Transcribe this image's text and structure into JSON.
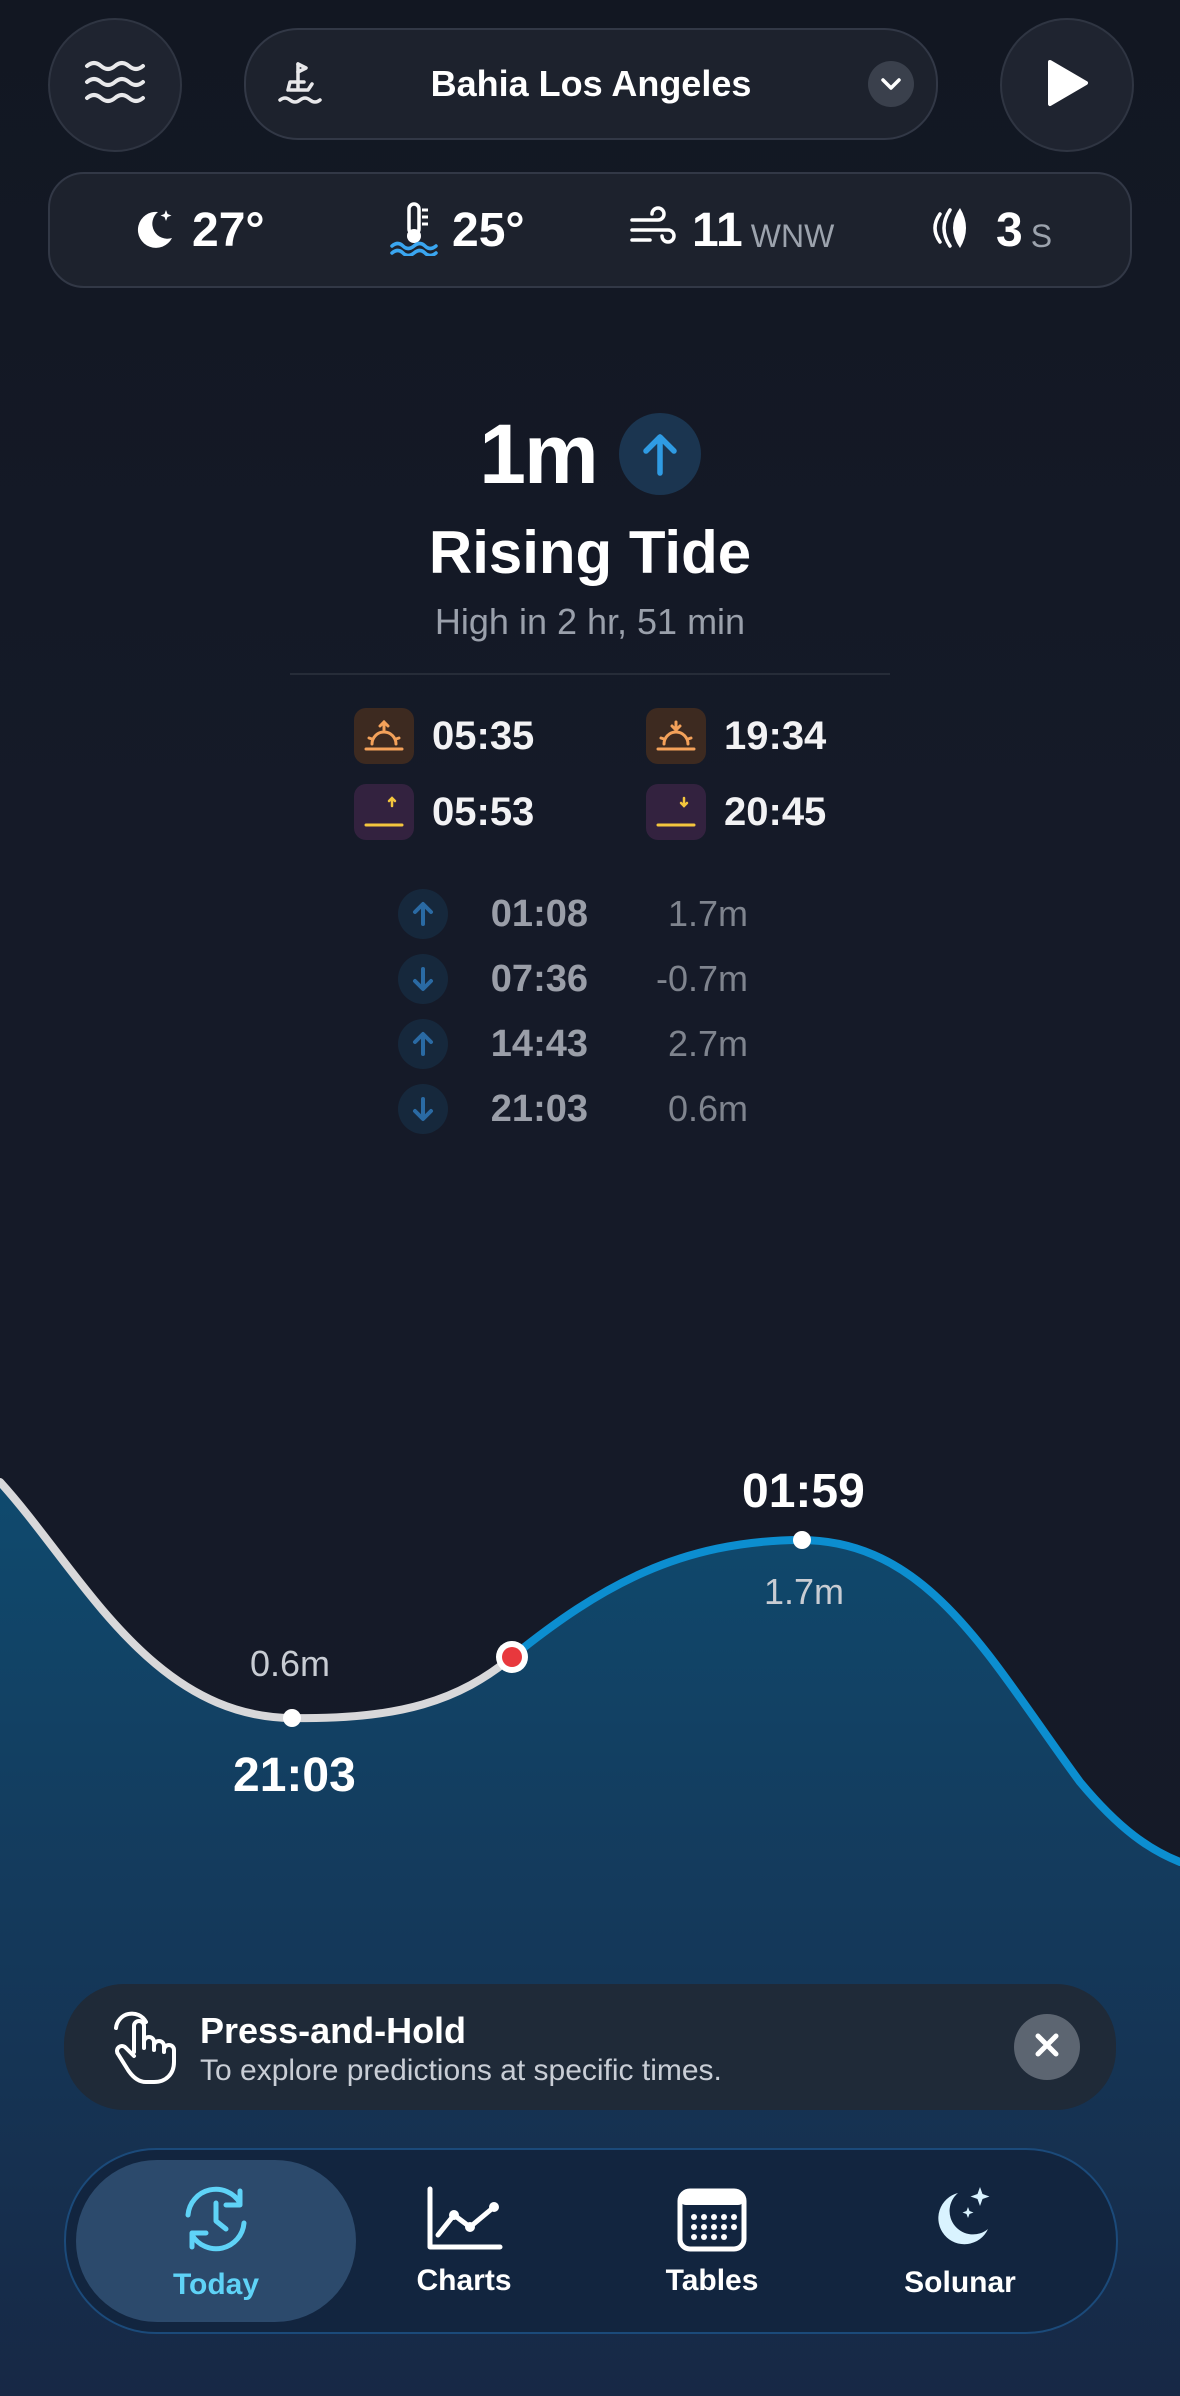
{
  "header": {
    "location": "Bahia Los Angeles"
  },
  "weather": {
    "air_temp": "27°",
    "water_temp": "25°",
    "wind_speed": "11",
    "wind_dir": "WNW",
    "swell_period": "3",
    "swell_unit": "S"
  },
  "tide": {
    "height": "1m",
    "state": "Rising Tide",
    "next": "High in 2 hr, 51 min"
  },
  "sun_moon": {
    "sunrise": "05:35",
    "sunset": "19:34",
    "moonrise": "05:53",
    "moonset": "20:45"
  },
  "tide_events": [
    {
      "direction": "up",
      "time": "01:08",
      "height": "1.7m"
    },
    {
      "direction": "down",
      "time": "07:36",
      "height": "-0.7m"
    },
    {
      "direction": "up",
      "time": "14:43",
      "height": "2.7m"
    },
    {
      "direction": "down",
      "time": "21:03",
      "height": "0.6m"
    }
  ],
  "chart": {
    "low_height": "0.6m",
    "low_time": "21:03",
    "high_time": "01:59",
    "high_height": "1.7m"
  },
  "hint": {
    "title": "Press-and-Hold",
    "subtitle": "To explore predictions at specific times."
  },
  "tabs": [
    {
      "label": "Today",
      "icon": "clock-refresh-icon",
      "active": true
    },
    {
      "label": "Charts",
      "icon": "line-chart-icon",
      "active": false
    },
    {
      "label": "Tables",
      "icon": "calendar-grid-icon",
      "active": false
    },
    {
      "label": "Solunar",
      "icon": "moon-stars-icon",
      "active": false
    }
  ],
  "colors": {
    "accent": "#2f9be3",
    "curve_past": "#d8d8da",
    "curve_future": "#0c8ed0",
    "marker_now": "#e8383d",
    "active_tab": "#5fd3f7"
  }
}
